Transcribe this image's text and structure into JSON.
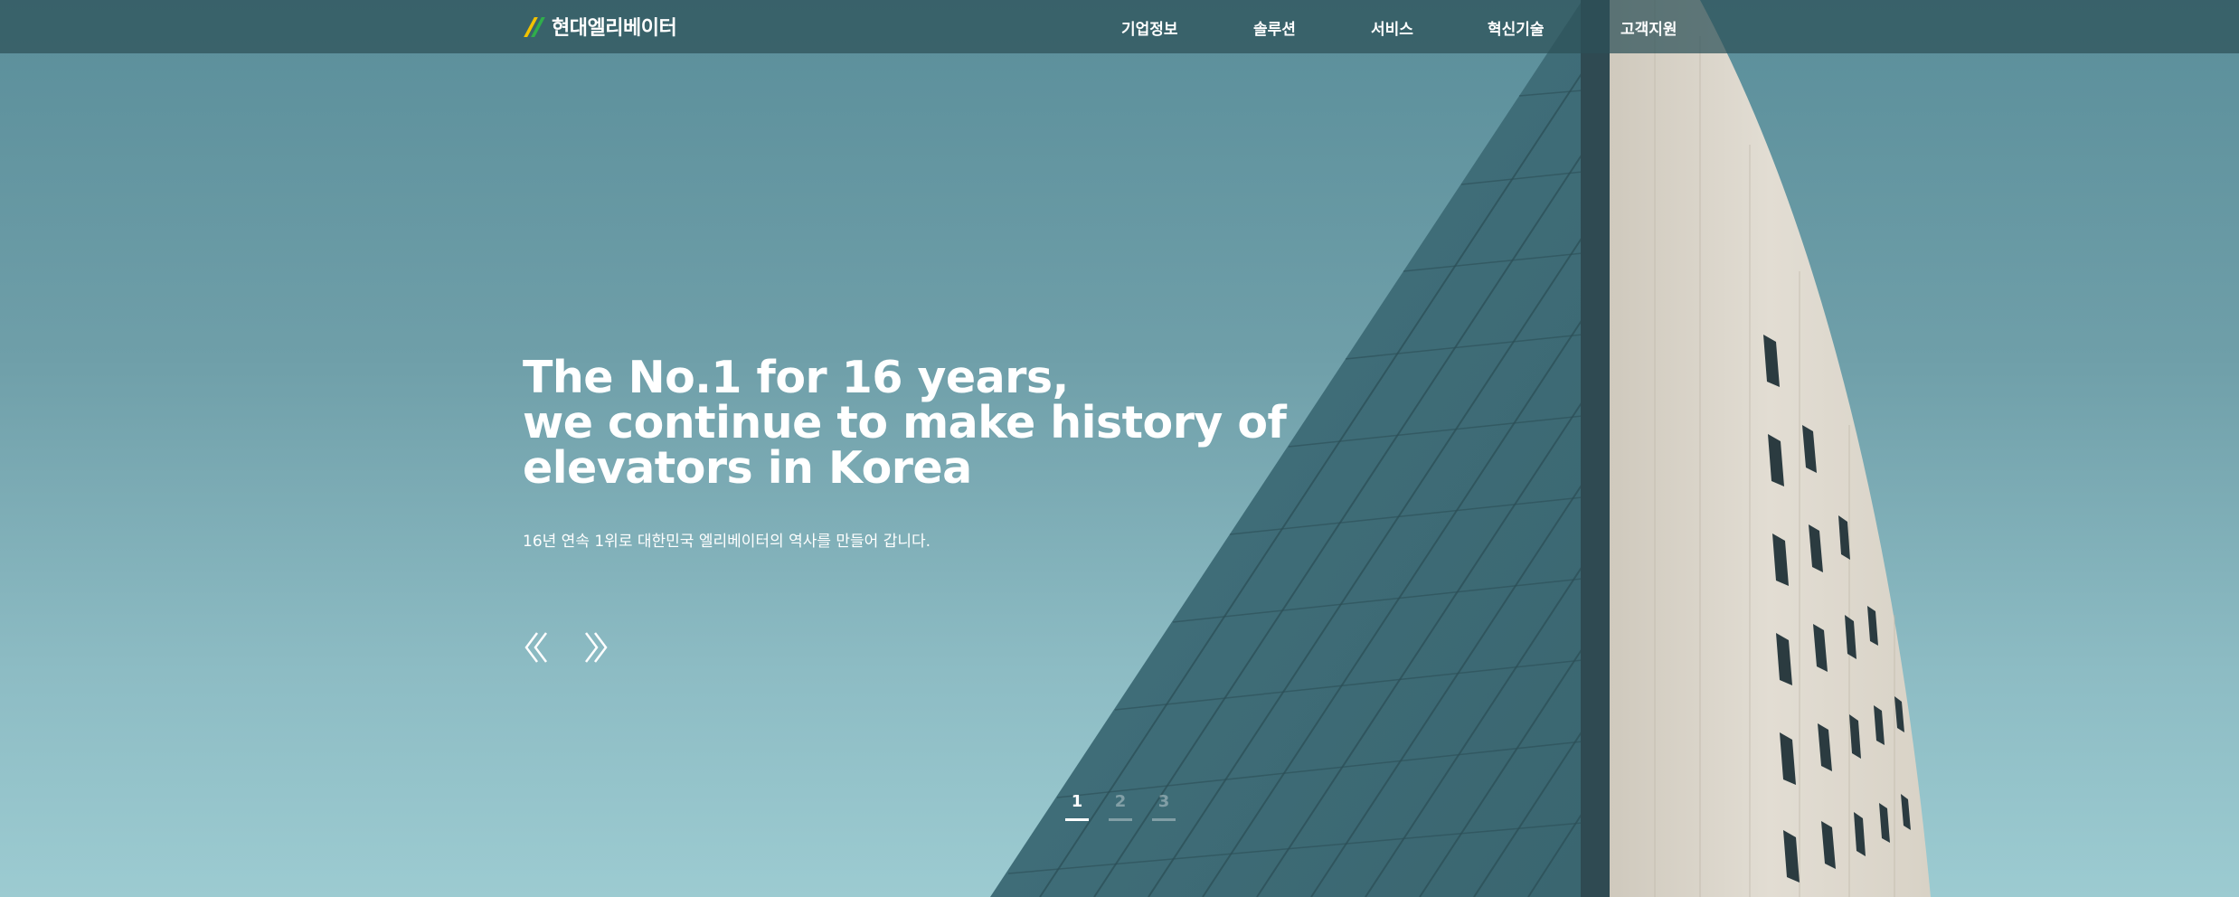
{
  "header": {
    "logo_text": "현대엘리베이터",
    "nav": [
      {
        "label": "기업정보"
      },
      {
        "label": "솔루션"
      },
      {
        "label": "서비스"
      },
      {
        "label": "혁신기술"
      },
      {
        "label": "고객지원"
      }
    ]
  },
  "hero": {
    "title_lines": [
      "The No.1 for 16 years,",
      "we continue to make history of",
      "elevators in Korea"
    ],
    "subtitle": "16년 연속 1위로 대한민국 엘리베이터의 역사를 만들어 갑니다.",
    "prev_icon": "double-chevron-left-icon",
    "next_icon": "double-chevron-right-icon"
  },
  "pagination": {
    "pages": [
      "1",
      "2",
      "3"
    ],
    "active": "1"
  },
  "colors": {
    "sky_top": "#5a8e9a",
    "sky_bottom": "#9ccbd1",
    "header_bg": "#2d5058",
    "logo_yellow": "#f2c200",
    "logo_green": "#2fae4a"
  }
}
